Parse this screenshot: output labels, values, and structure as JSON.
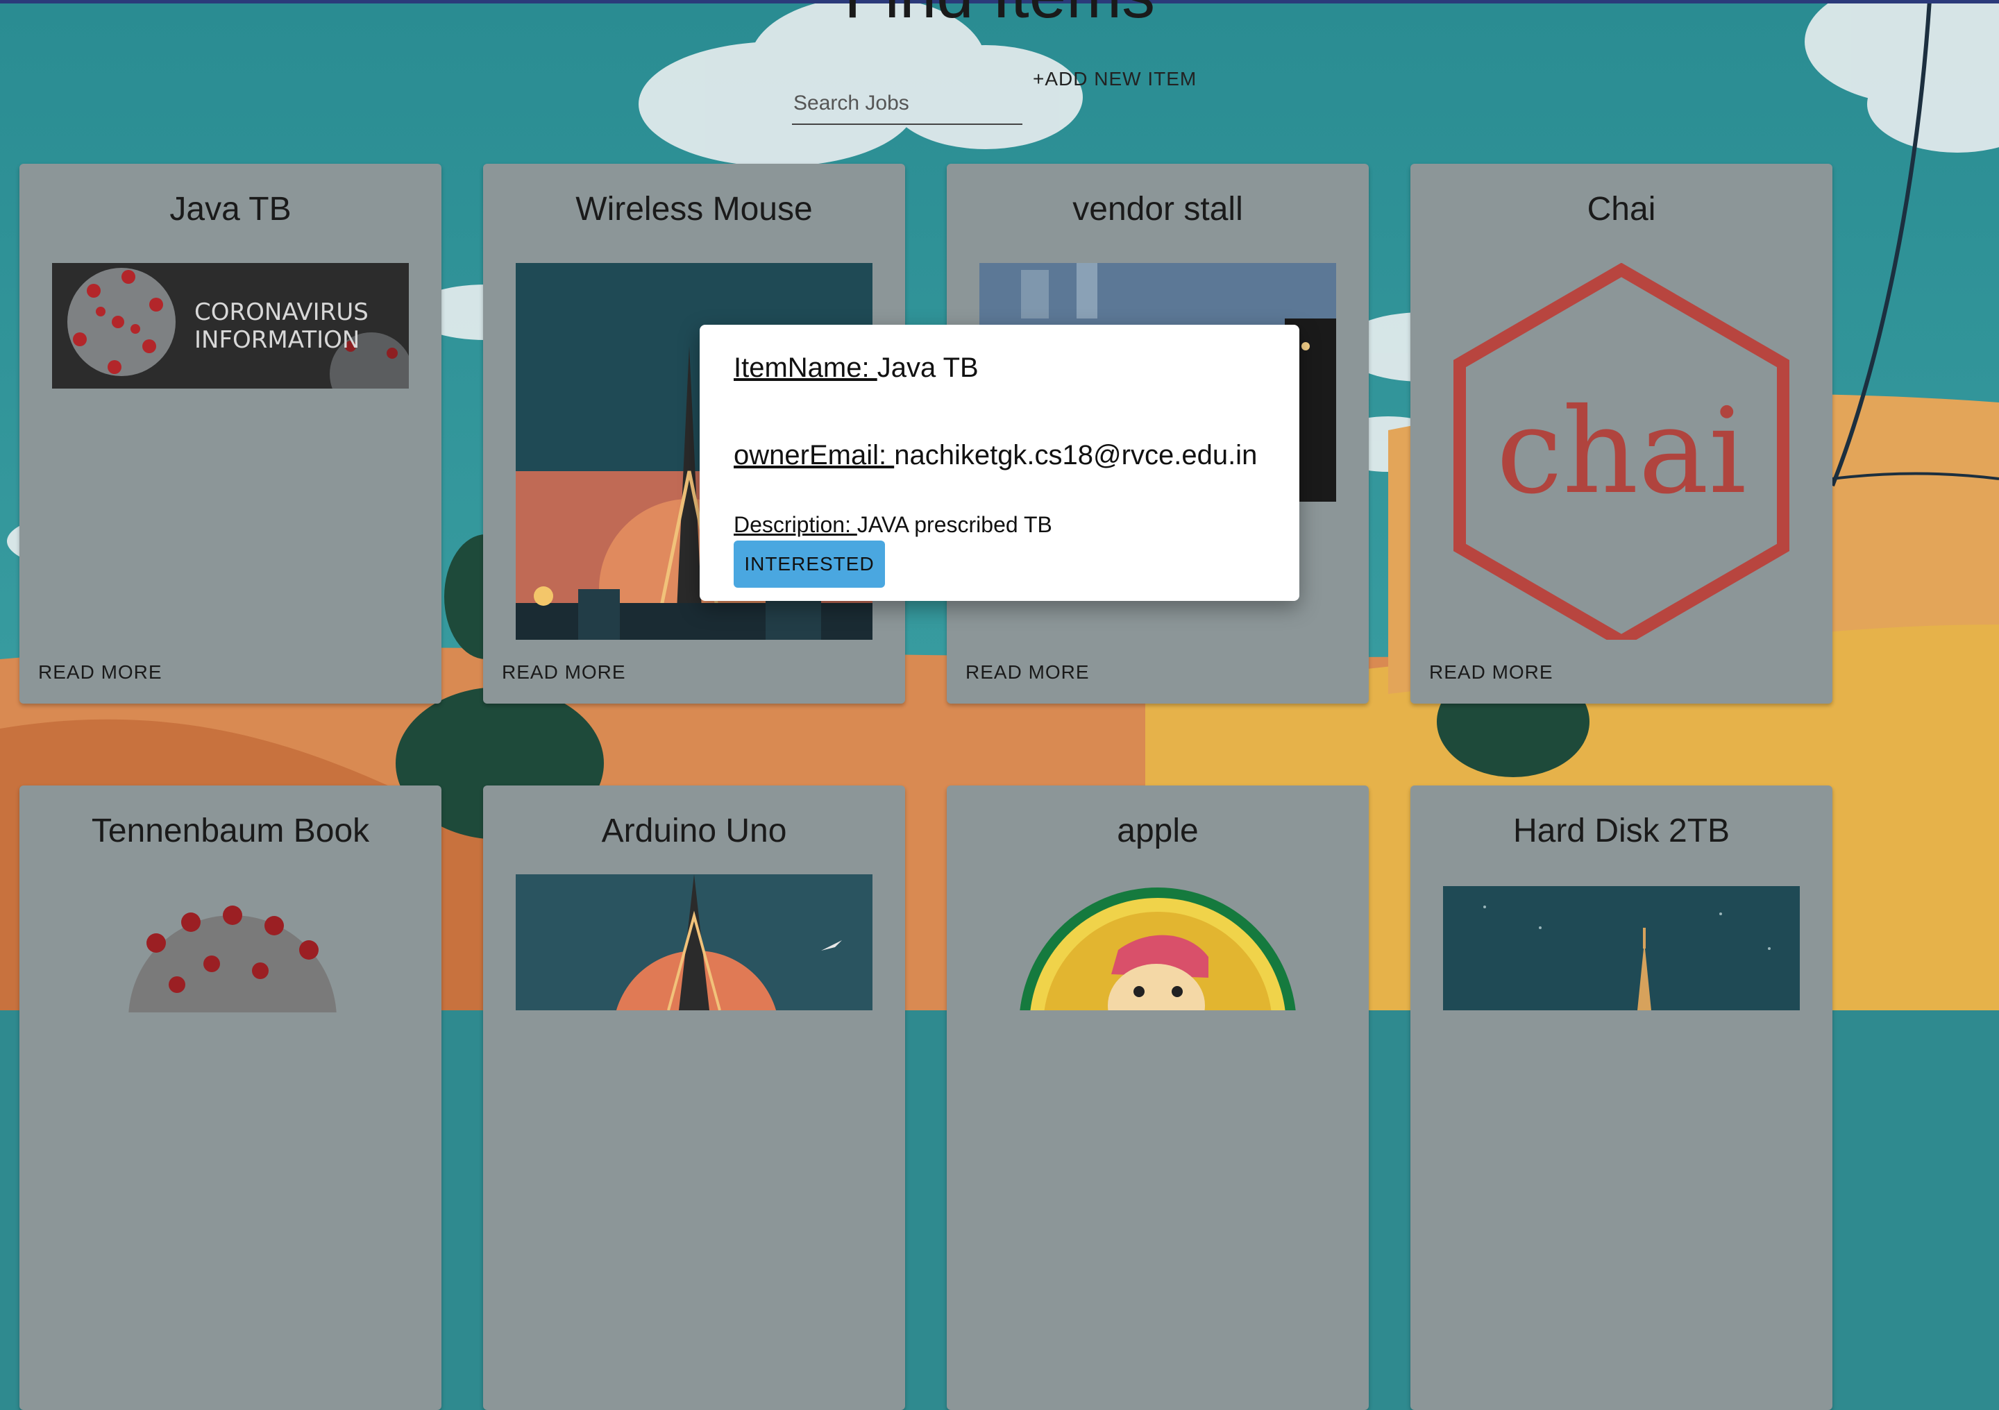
{
  "page": {
    "title": "Find Items",
    "search_placeholder": "Search Jobs",
    "add_button_label": "+ADD NEW ITEM"
  },
  "cards": [
    {
      "title": "Java TB",
      "action": "READ MORE",
      "image": "coronavirus-information-banner",
      "banner_line1": "CORONAVIRUS",
      "banner_line2": "INFORMATION"
    },
    {
      "title": "Wireless Mouse",
      "action": "READ MORE",
      "image": "eiffel-tower-night-illustration"
    },
    {
      "title": "vendor stall",
      "action": "READ MORE",
      "image": "street-photo"
    },
    {
      "title": "Chai",
      "action": "READ MORE",
      "image": "chai-hexagon-logo",
      "logo_text": "chai"
    },
    {
      "title": "Tennenbaum Book",
      "image": "coronavirus-illustration"
    },
    {
      "title": "Arduino Uno",
      "image": "eiffel-tower-sunset-illustration"
    },
    {
      "title": "apple",
      "image": "mascot-badge"
    },
    {
      "title": "Hard Disk 2TB",
      "image": "eiffel-tower-night-illustration"
    }
  ],
  "modal": {
    "item_name_label": "ItemName: ",
    "item_name": "Java TB",
    "owner_email_label": "ownerEmail: ",
    "owner_email": "nachiketgk.cs18@rvce.edu.in",
    "description_label": "Description: ",
    "description": "JAVA prescribed TB",
    "interested_label": "INTERESTED"
  },
  "colors": {
    "sky": "#2f8a8f",
    "card": "#8c9698",
    "button": "#4aa7e0",
    "top_bar": "#2b3a7a"
  }
}
